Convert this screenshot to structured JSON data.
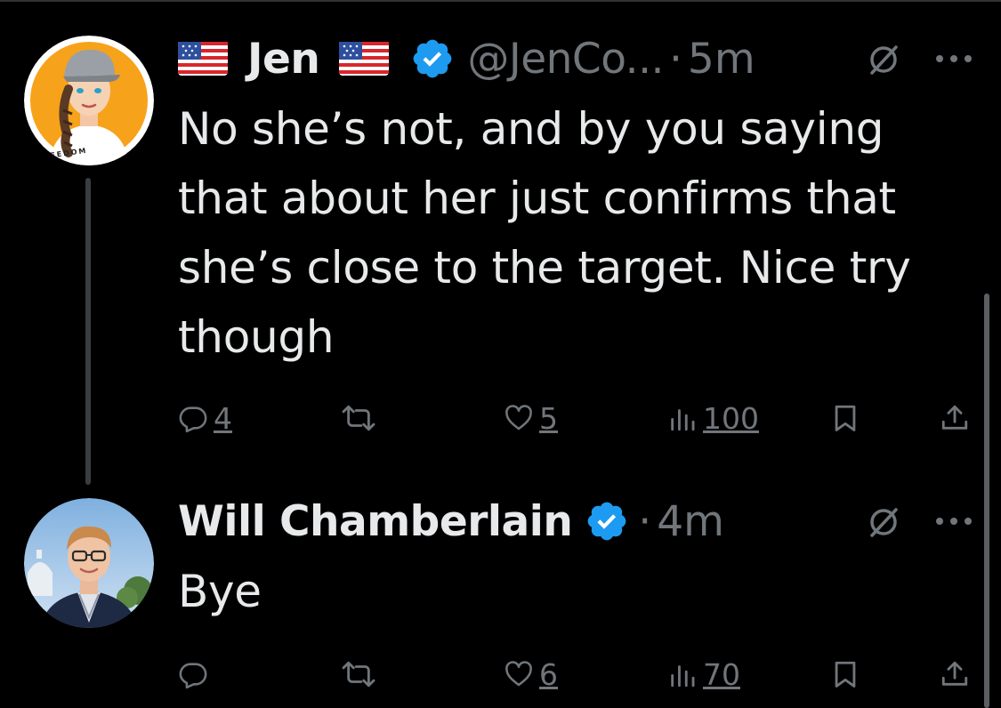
{
  "tweets": [
    {
      "display_name": "Jen",
      "name_flags": [
        "us-flag",
        "us-flag"
      ],
      "verified": true,
      "handle": "@JenCo...",
      "separator": "·",
      "time": "5m",
      "text_lines": [
        "No she’s not, and by you saying",
        "that about her just confirms that",
        "she’s close to the target. Nice try",
        "though"
      ],
      "avatar": {
        "icon": "avatar-cap-woman",
        "badge_text": "FREEDOM",
        "bg_color": "#f7a21b"
      },
      "actions": {
        "reply_count": "4",
        "repost_count": "",
        "like_count": "5",
        "views_count": "100"
      }
    },
    {
      "display_name": "Will Chamberlain",
      "verified": true,
      "separator": "·",
      "time": "4m",
      "text_lines": [
        "Bye"
      ],
      "avatar": {
        "icon": "avatar-man-photo"
      },
      "actions": {
        "reply_count": "",
        "repost_count": "",
        "like_count": "6",
        "views_count": "70"
      }
    }
  ],
  "colors": {
    "background": "#000000",
    "primary_text": "#e7e9ea",
    "secondary_text": "#71767b",
    "verified_blue": "#1d9bf0",
    "thread_line": "#3a3d40"
  },
  "icons": [
    "reply-icon",
    "repost-icon",
    "like-icon",
    "views-icon",
    "bookmark-icon",
    "share-icon",
    "grok-icon",
    "more-icon",
    "verified-icon",
    "us-flag-icon"
  ]
}
